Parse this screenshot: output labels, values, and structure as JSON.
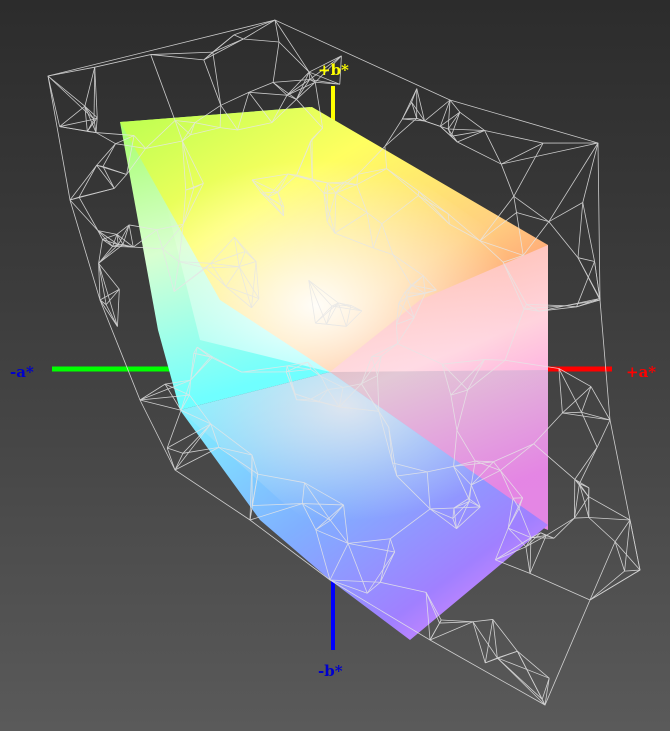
{
  "axes": {
    "plus_a": {
      "label": "+a*",
      "color": "#ff0000"
    },
    "minus_a": {
      "label": "-a*",
      "color": "#00ff00",
      "label_color": "#0000cc"
    },
    "plus_b": {
      "label": "+b*",
      "color": "#ffff00"
    },
    "minus_b": {
      "label": "-b*",
      "color": "#0000ff",
      "label_color": "#0000cc"
    }
  },
  "colors": {
    "wireframe": "#e6e6e6",
    "background_top": "#2c2c2c",
    "background_bottom": "#5a5a5a"
  }
}
